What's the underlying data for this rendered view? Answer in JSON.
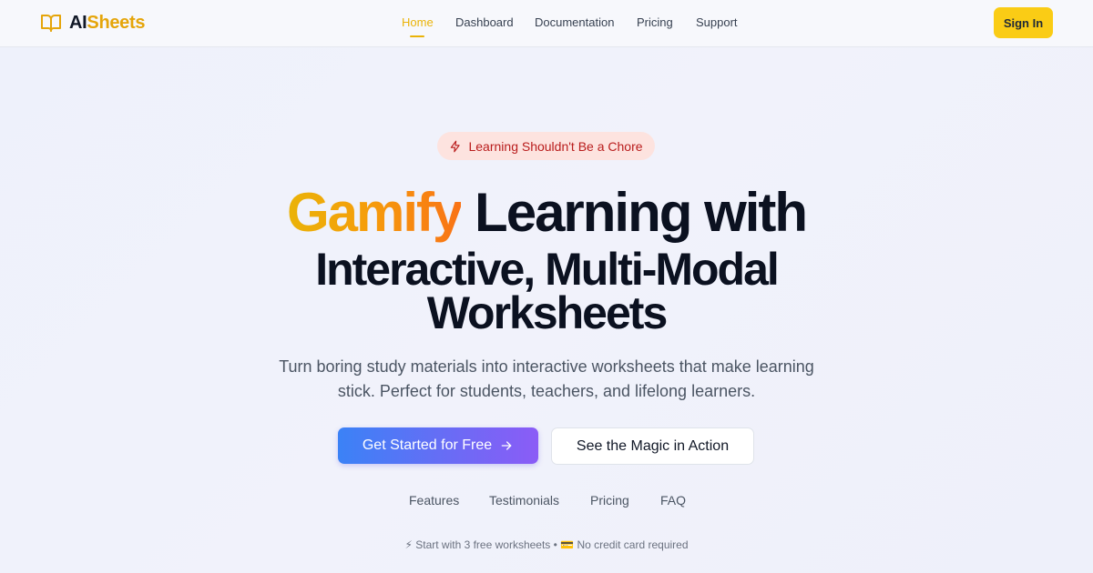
{
  "brand": {
    "name_part1": "AI",
    "name_part2": "Sheets",
    "icon": "open-book-icon",
    "accent": "#e5a50a"
  },
  "nav": {
    "items": [
      {
        "label": "Home",
        "active": true
      },
      {
        "label": "Dashboard",
        "active": false
      },
      {
        "label": "Documentation",
        "active": false
      },
      {
        "label": "Pricing",
        "active": false
      },
      {
        "label": "Support",
        "active": false
      }
    ],
    "signin_label": "Sign In"
  },
  "hero": {
    "badge": {
      "text": "Learning Shouldn't Be a Chore",
      "icon": "lightning-icon"
    },
    "headline_highlight": "Gamify",
    "headline_rest_line1": " Learning with",
    "headline_line2": "Interactive, Multi-Modal",
    "headline_line3": "Worksheets",
    "subtitle_line1": "Turn boring study materials into interactive worksheets that make learning",
    "subtitle_line2": "stick. Perfect for students, teachers, and lifelong learners.",
    "cta_primary": "Get Started for Free",
    "cta_secondary": "See the Magic in Action"
  },
  "section_links": [
    "Features",
    "Testimonials",
    "Pricing",
    "FAQ"
  ],
  "note": "⚡ Start with 3 free worksheets • 💳 No credit card required",
  "colors": {
    "accent_yellow": "#facc15",
    "badge_bg": "#fde3df",
    "badge_text": "#b91c1c",
    "cta_start": "#3b82f6",
    "cta_end": "#8b5cf6"
  }
}
